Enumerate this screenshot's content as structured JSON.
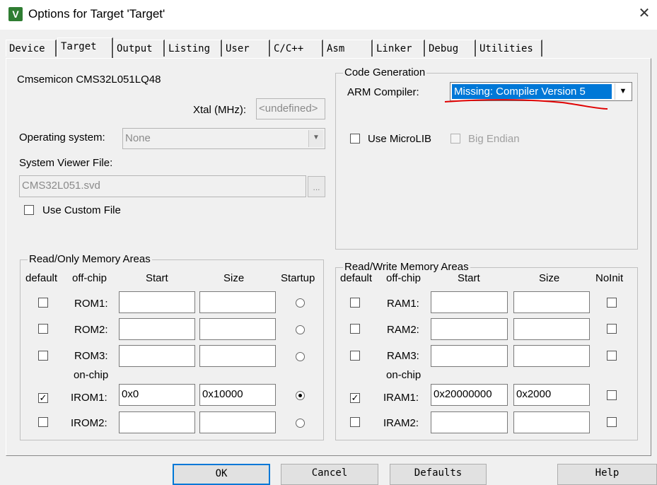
{
  "window": {
    "title": "Options for Target 'Target'",
    "app_icon": "keil-uvision-icon"
  },
  "tabs": [
    {
      "label": "Device"
    },
    {
      "label": "Target"
    },
    {
      "label": "Output"
    },
    {
      "label": "Listing"
    },
    {
      "label": "User"
    },
    {
      "label": "C/C++"
    },
    {
      "label": "Asm"
    },
    {
      "label": "Linker"
    },
    {
      "label": "Debug"
    },
    {
      "label": "Utilities"
    }
  ],
  "device": {
    "name": "Cmsemicon CMS32L051LQ48",
    "xtal_label": "Xtal (MHz):",
    "xtal_value": "<undefined>",
    "os_label": "Operating system:",
    "os_value": "None",
    "svd_label": "System Viewer File:",
    "svd_value": "CMS32L051.svd",
    "browse_label": "...",
    "custom_file_label": "Use Custom File"
  },
  "code_gen": {
    "title": "Code Generation",
    "compiler_label": "ARM Compiler:",
    "compiler_value": "Missing: Compiler Version 5",
    "microlib_label": "Use MicroLIB",
    "big_endian_label": "Big Endian",
    "annotation_color": "#e00000"
  },
  "ro_mem": {
    "title": "Read/Only Memory Areas",
    "headers": {
      "default": "default",
      "offchip": "off-chip",
      "start": "Start",
      "size": "Size",
      "extra": "Startup"
    },
    "onchip_label": "on-chip",
    "rows": [
      {
        "name": "ROM1:",
        "start": "",
        "size": "",
        "default": false,
        "radio": false
      },
      {
        "name": "ROM2:",
        "start": "",
        "size": "",
        "default": false,
        "radio": false
      },
      {
        "name": "ROM3:",
        "start": "",
        "size": "",
        "default": false,
        "radio": false
      },
      {
        "name": "IROM1:",
        "start": "0x0",
        "size": "0x10000",
        "default": true,
        "radio": true
      },
      {
        "name": "IROM2:",
        "start": "",
        "size": "",
        "default": false,
        "radio": false
      }
    ]
  },
  "rw_mem": {
    "title": "Read/Write Memory Areas",
    "headers": {
      "default": "default",
      "offchip": "off-chip",
      "start": "Start",
      "size": "Size",
      "extra": "NoInit"
    },
    "onchip_label": "on-chip",
    "rows": [
      {
        "name": "RAM1:",
        "start": "",
        "size": "",
        "default": false,
        "noinit": false
      },
      {
        "name": "RAM2:",
        "start": "",
        "size": "",
        "default": false,
        "noinit": false
      },
      {
        "name": "RAM3:",
        "start": "",
        "size": "",
        "default": false,
        "noinit": false
      },
      {
        "name": "IRAM1:",
        "start": "0x20000000",
        "size": "0x2000",
        "default": true,
        "noinit": false
      },
      {
        "name": "IRAM2:",
        "start": "",
        "size": "",
        "default": false,
        "noinit": false
      }
    ]
  },
  "buttons": {
    "ok": "OK",
    "cancel": "Cancel",
    "defaults": "Defaults",
    "help": "Help"
  }
}
